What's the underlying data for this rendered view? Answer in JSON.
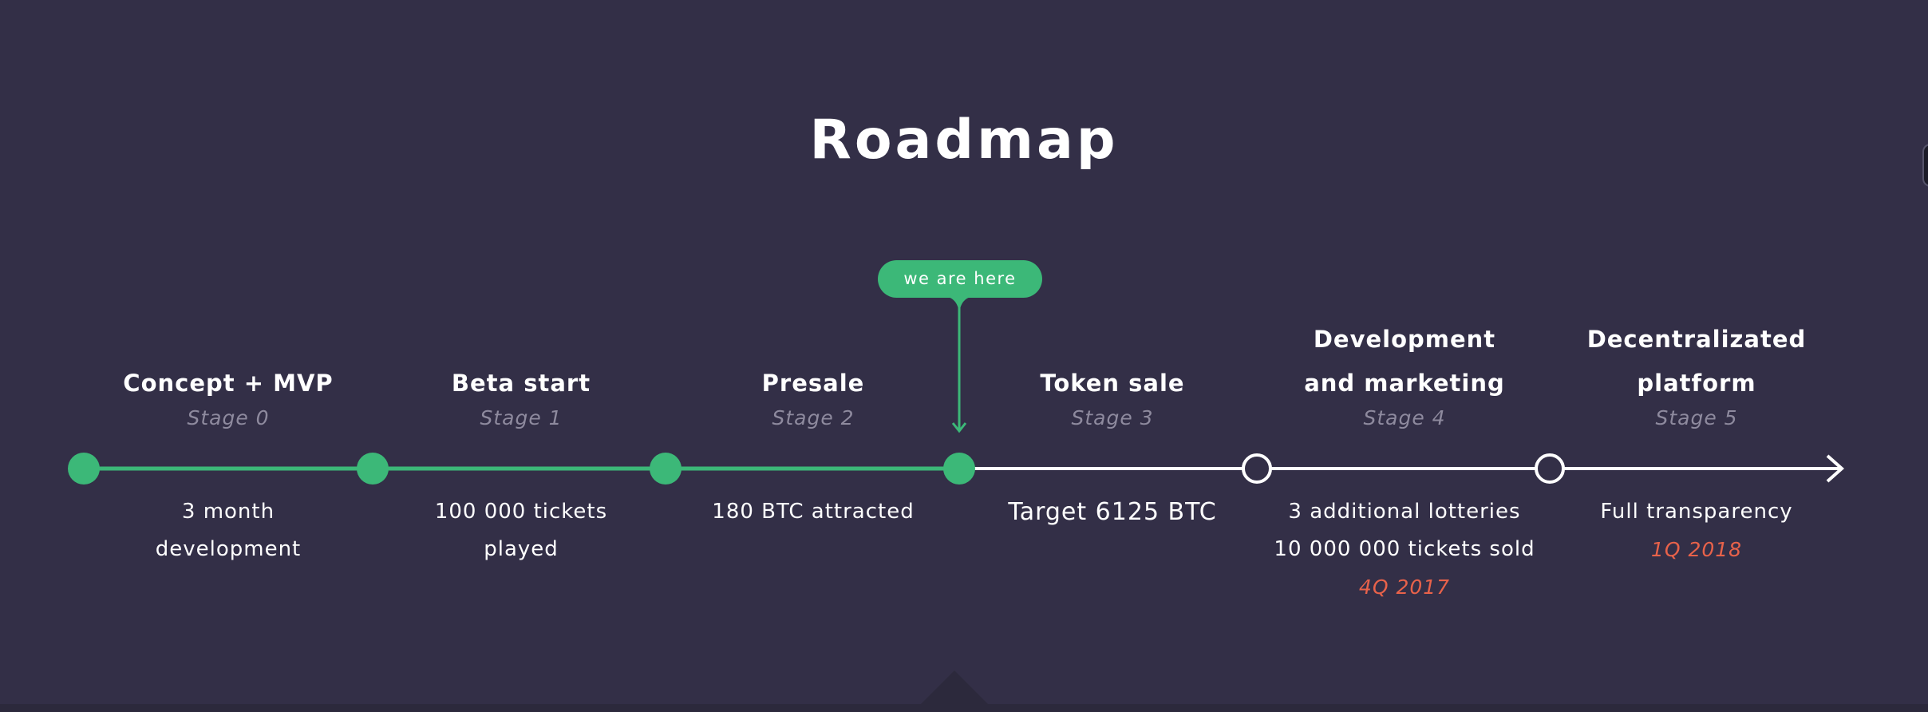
{
  "title": "Roadmap",
  "current_marker": {
    "label": "we are here",
    "stage_index": 3
  },
  "colors": {
    "background": "#332f47",
    "accent": "#3cb878",
    "date": "#e8624a",
    "muted": "#8e8a9e",
    "future_line": "#ffffff"
  },
  "stages": [
    {
      "title_lines": [
        "Concept + MVP"
      ],
      "stage": "Stage 0",
      "desc": [
        "3 month",
        "development"
      ],
      "date": "",
      "status": "done"
    },
    {
      "title_lines": [
        "Beta start"
      ],
      "stage": "Stage 1",
      "desc": [
        "100 000 tickets",
        "played"
      ],
      "date": "",
      "status": "done"
    },
    {
      "title_lines": [
        "Presale"
      ],
      "stage": "Stage 2",
      "desc": [
        "180 BTC attracted"
      ],
      "date": "",
      "status": "done"
    },
    {
      "title_lines": [
        "Token sale"
      ],
      "stage": "Stage 3",
      "desc": [
        "Target 6125 BTC"
      ],
      "date": "",
      "status": "current"
    },
    {
      "title_lines": [
        "Development",
        "and marketing"
      ],
      "stage": "Stage 4",
      "desc": [
        "3 additional lotteries",
        "10 000 000 tickets sold"
      ],
      "date": "4Q 2017",
      "status": "future"
    },
    {
      "title_lines": [
        "Decentralizated",
        "platform"
      ],
      "stage": "Stage 5",
      "desc": [
        "Full transparency"
      ],
      "date": "1Q 2018",
      "status": "future"
    }
  ]
}
